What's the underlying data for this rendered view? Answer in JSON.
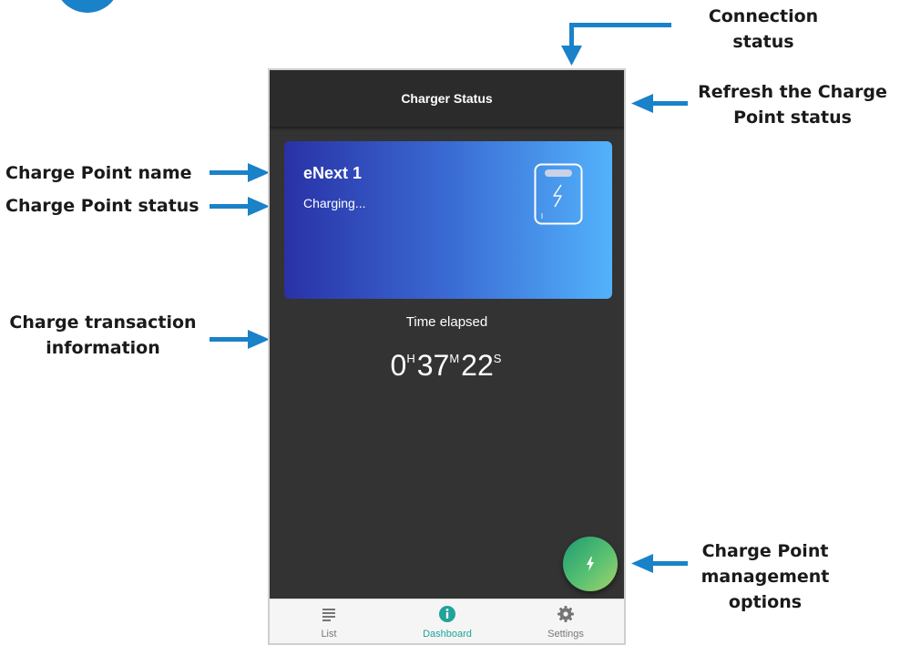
{
  "app": {
    "title": "Charger Status"
  },
  "card": {
    "name": "eNext 1",
    "status": "Charging..."
  },
  "timer": {
    "label": "Time elapsed",
    "hours": "0",
    "hours_unit": "H",
    "minutes": "37",
    "minutes_unit": "M",
    "seconds": "22",
    "seconds_unit": "S"
  },
  "bottom_nav": {
    "items": [
      {
        "label": "List",
        "icon": "list-icon",
        "active": false
      },
      {
        "label": "Dashboard",
        "icon": "info-icon",
        "active": true
      },
      {
        "label": "Settings",
        "icon": "gear-icon",
        "active": false
      }
    ]
  },
  "fab": {
    "icon": "lightning-bolt-icon"
  },
  "callouts": {
    "connection_status": [
      "Connection",
      "status"
    ],
    "refresh_status": [
      "Refresh the Charge",
      "Point status"
    ],
    "charge_point_name": "Charge Point name",
    "charge_point_status": "Charge Point status",
    "transaction_info": [
      "Charge transaction",
      "information"
    ],
    "management_options": [
      "Charge Point",
      "management",
      "options"
    ]
  },
  "colors": {
    "arrow": "#1a82c8",
    "app_background": "#333333",
    "app_bar": "#2b2b2b",
    "active_nav": "#1fa39a",
    "card_gradient_start": "#2932a6",
    "card_gradient_end": "#52b2fb"
  }
}
